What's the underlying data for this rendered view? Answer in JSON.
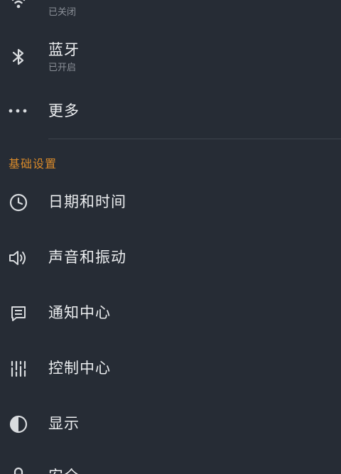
{
  "items_top": [
    {
      "key": "wifi",
      "icon": "wifi-icon",
      "subtitle": "已关闭"
    },
    {
      "key": "bluetooth",
      "icon": "bluetooth-icon",
      "title": "蓝牙",
      "subtitle": "已开启"
    },
    {
      "key": "more",
      "icon": "more-dots-icon",
      "title": "更多"
    }
  ],
  "section_basic": {
    "header": "基础设置",
    "items": [
      {
        "key": "datetime",
        "icon": "clock-icon",
        "title": "日期和时间"
      },
      {
        "key": "sound",
        "icon": "speaker-icon",
        "title": "声音和振动"
      },
      {
        "key": "notification",
        "icon": "message-icon",
        "title": "通知中心"
      },
      {
        "key": "control",
        "icon": "sliders-icon",
        "title": "控制中心"
      },
      {
        "key": "display",
        "icon": "contrast-icon",
        "title": "显示"
      },
      {
        "key": "security",
        "icon": "lock-icon",
        "title": "安全"
      }
    ]
  },
  "colors": {
    "background": "#262c35",
    "accent": "#d98a2a",
    "text": "#eceef0",
    "subtext": "#8b9098"
  }
}
